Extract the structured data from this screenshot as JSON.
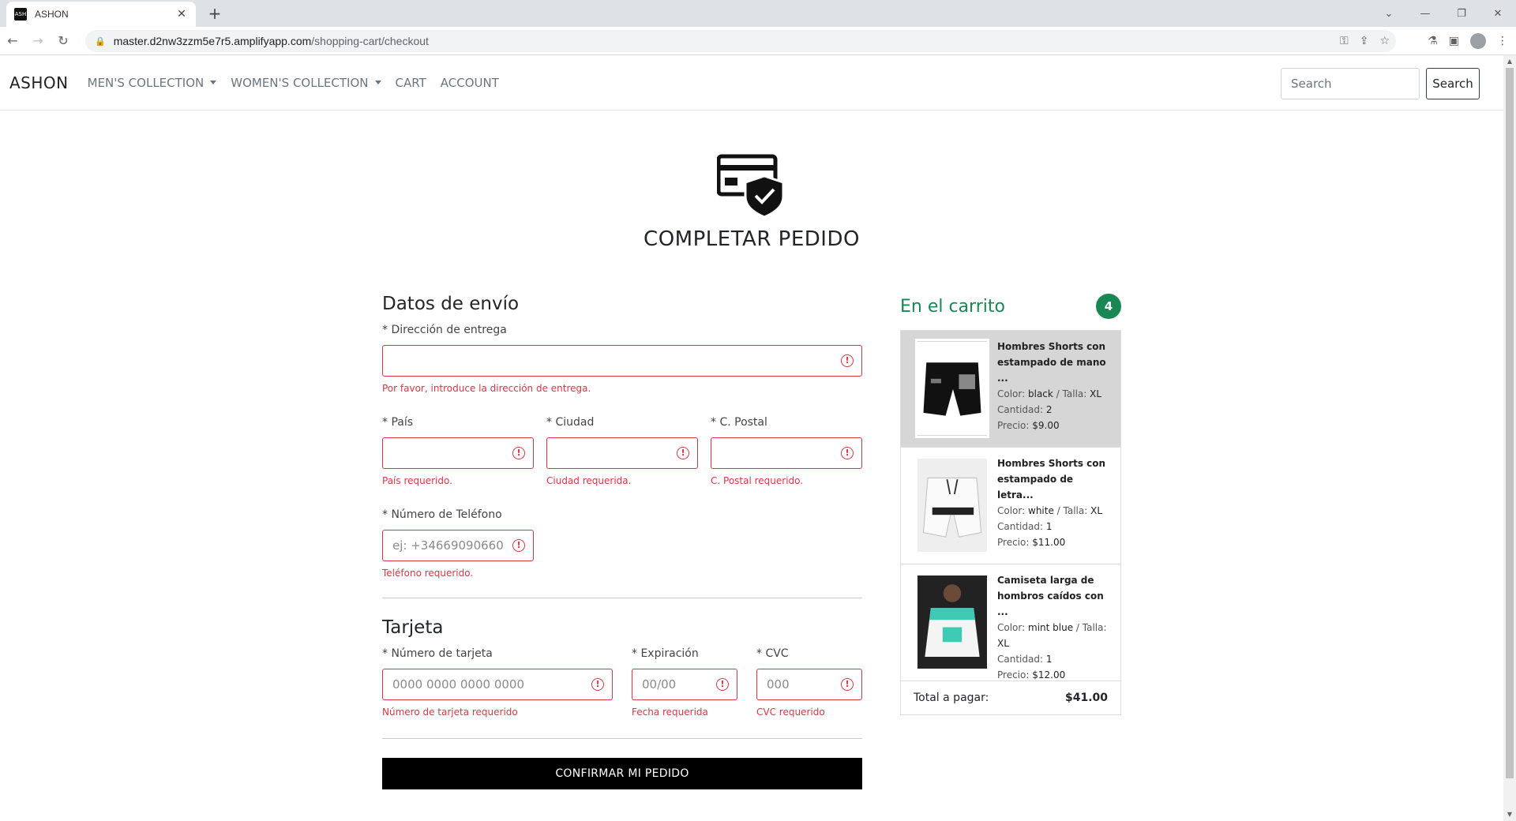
{
  "browser": {
    "tab_title": "ASHON",
    "favicon_text": "ASH",
    "url_host": "master.d2nw3zzm5e7r5.amplifyapp.com",
    "url_path": "/shopping-cart/checkout"
  },
  "navbar": {
    "brand": "ASHON",
    "links": [
      "MEN'S COLLECTION",
      "WOMEN'S COLLECTION",
      "CART",
      "ACCOUNT"
    ],
    "search_placeholder": "Search",
    "search_button": "Search"
  },
  "page": {
    "title": "COMPLETAR PEDIDO"
  },
  "shipping": {
    "heading": "Datos de envío",
    "address_label": "* Dirección de entrega",
    "address_error": "Por favor, introduce la dirección de entrega.",
    "country_label": "* País",
    "country_error": "País requerido.",
    "city_label": "* Ciudad",
    "city_error": "Ciudad requerida.",
    "postal_label": "* C. Postal",
    "postal_error": "C. Postal requerido.",
    "phone_label": "* Número de Teléfono",
    "phone_placeholder": "ej: +34669090660",
    "phone_error": "Teléfono requerido."
  },
  "card": {
    "heading": "Tarjeta",
    "number_label": "* Número de tarjeta",
    "number_placeholder": "0000 0000 0000 0000",
    "number_error": "Número de tarjeta requerido",
    "expiry_label": "* Expiración",
    "expiry_placeholder": "00/00",
    "expiry_error": "Fecha requerida",
    "cvc_label": "* CVC",
    "cvc_placeholder": "000",
    "cvc_error": "CVC requerido"
  },
  "confirm_button": "CONFIRMAR MI PEDIDO",
  "cart": {
    "title": "En el carrito",
    "count": "4",
    "items": [
      {
        "name": "Hombres Shorts con estampado de mano ...",
        "color_label": "Color:",
        "color": "black",
        "size_label": "/ Talla:",
        "size": "XL",
        "qty_label": "Cantidad:",
        "qty": "2",
        "price_label": "Precio:",
        "price": "$9.00"
      },
      {
        "name": "Hombres Shorts con estampado de letra...",
        "color_label": "Color:",
        "color": "white",
        "size_label": "/ Talla:",
        "size": "XL",
        "qty_label": "Cantidad:",
        "qty": "1",
        "price_label": "Precio:",
        "price": "$11.00"
      },
      {
        "name": "Camiseta larga de hombros caídos con ...",
        "color_label": "Color:",
        "color": "mint blue",
        "size_label": "/ Talla:",
        "size": "XL",
        "qty_label": "Cantidad:",
        "qty": "1",
        "price_label": "Precio:",
        "price": "$12.00"
      }
    ],
    "total_label": "Total a pagar:",
    "total_value": "$41.00"
  }
}
